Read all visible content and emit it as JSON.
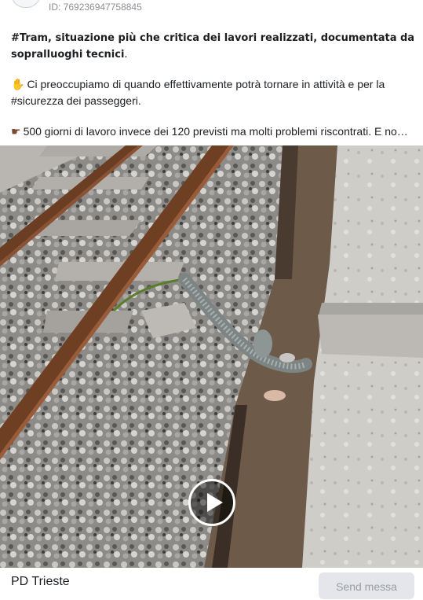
{
  "post": {
    "id_label": "ID: 769236947758845",
    "headline": "#Tram, situazione più che critica dei lavori realizzati, documentata da sopralluoghi tecnici",
    "headline_end": ".",
    "para2_emoji": "hand-emoji",
    "para2": "Ci preoccupiamo di quando effettivamente potrà tornare in attività e per la #sicurezza dei passeggeri.",
    "para3_emoji": "pointing-finger-emoji",
    "para3": "500 giorni di lavoro invece dei 120 previsti ma molti problemi riscontrati. E no…"
  },
  "media": {
    "type": "video",
    "play_icon": "play-icon"
  },
  "footer": {
    "page_name": "PD Trieste",
    "send_label": "Send messa"
  }
}
